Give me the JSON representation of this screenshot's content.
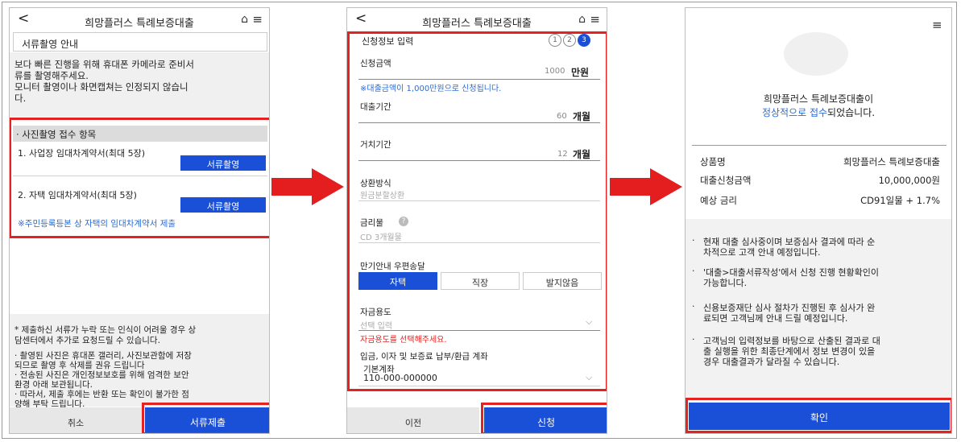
{
  "panel1": {
    "header": {
      "back": "<",
      "title": "희망플러스 특례보증대출"
    },
    "section_title": "서류촬영 안내",
    "intro": [
      "보다 빠른 진행을 위해 휴대폰 카메라로 준비서",
      "류를 촬영해주세요.",
      "모니터 촬영이나 화면캡쳐는 인정되지 않습니",
      "다."
    ],
    "items_title": "· 사진촬영 접수 항목",
    "item1": "1. 사업장 임대차계약서(최대 5장)",
    "item2": "2. 자택 임대차계약서(최대 5장)",
    "capture_label": "서류촬영",
    "notice_blue": "※주민등록등본 상 자택의 임대차계약서 제출",
    "footer_notes": [
      "* 제출하신 서류가 누락 또는 인식이 어려울 경우 상",
      "담센터에서 추가로 요청드릴 수 있습니다.",
      "· 촬영된 사진은 휴대폰 갤러리, 사진보관함에 저장",
      "되므로 촬영 후 삭제를 권유 드립니다",
      "· 전송된 사진은 개인정보보호를 위해 엄격한 보안",
      "환경 아래 보관됩니다.",
      "· 따라서, 제출 후에는 반환 또는 확인이 불가한 점",
      "양해 부탁 드립니다."
    ],
    "cancel": "취소",
    "submit": "서류제출"
  },
  "panel2": {
    "header": {
      "back": "<",
      "title": "희망플러스 특례보증대출"
    },
    "section_title": "신청정보 입력",
    "steps": [
      "1",
      "2",
      "3"
    ],
    "amount_label": "신청금액",
    "amount_value": "1000",
    "amount_unit": "만원",
    "amount_note": "※대출금액이 1,000만원으로 신청됩니다.",
    "term_label": "대출기간",
    "term_value": "60",
    "term_unit": "개월",
    "grace_label": "거치기간",
    "grace_value": "12",
    "grace_unit": "개월",
    "repay_label": "상환방식",
    "repay_value": "원금분할상환",
    "rate_label": "금리물",
    "rate_value": "CD 3개월물",
    "mail_label": "만기안내 우편송달",
    "mail_options": [
      "자택",
      "직장",
      "발지않음"
    ],
    "purpose_label": "자금용도",
    "purpose_placeholder": "선택 입력",
    "purpose_error": "자금용도를 선택해주세요.",
    "account_label": "입금, 이자 및 보증료 납부/환급 계좌",
    "account_type": "기본계좌",
    "account_number": "110-000-000000",
    "prev": "이전",
    "apply": "신청"
  },
  "panel3": {
    "msg_line1": "희망플러스 특례보증대출이",
    "msg_line2_blue": "정상적으로 접수",
    "msg_line2_rest": "되었습니다.",
    "rows": [
      {
        "label": "상품명",
        "value": "희망플러스 특례보증대출"
      },
      {
        "label": "대출신청금액",
        "value": "10,000,000원"
      },
      {
        "label": "예상 금리",
        "value": "CD91일물 + 1.7%"
      }
    ],
    "bullets": [
      [
        "현재 대출 심사중이며 보증심사 결과에 따라 순",
        "차적으로 고객 안내 예정입니다."
      ],
      [
        "'대출>대출서류작성'에서 신청 진행 현황확인이",
        "가능합니다."
      ],
      [
        "신용보증재단 심사 절차가 진행된 후 심사가 완",
        "료되면 고객님께 안내 드릴 예정입니다."
      ],
      [
        "고객님의 입력정보를 바탕으로 산출된 결과로 대",
        "출 실행을 위한 최종단계에서 정보 변경이 있을",
        "경우 대출결과가 달라질 수 있습니다."
      ]
    ],
    "confirm": "확인"
  },
  "colors": {
    "blue_button": "#1a4fd8",
    "red_highlight": "#e52222",
    "link_blue": "#2a6cd8"
  }
}
